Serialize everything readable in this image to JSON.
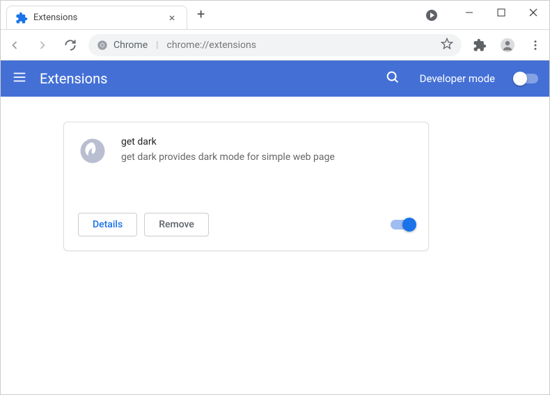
{
  "tab": {
    "title": "Extensions"
  },
  "addressbar": {
    "prefix": "Chrome",
    "url": "chrome://extensions"
  },
  "header": {
    "title": "Extensions",
    "dev_mode_label": "Developer mode"
  },
  "extension": {
    "name": "get dark",
    "description": "get dark provides dark mode for simple web page",
    "details_label": "Details",
    "remove_label": "Remove"
  }
}
